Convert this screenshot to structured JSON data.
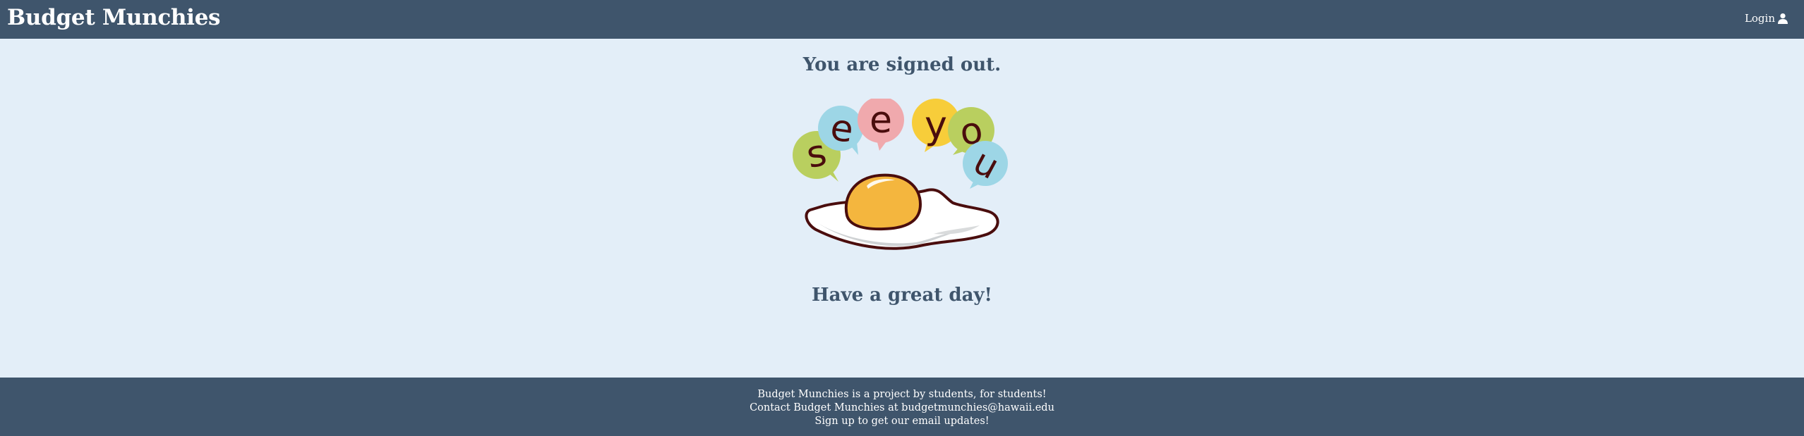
{
  "navbar": {
    "brand": "Budget Munchies",
    "login_label": "Login",
    "login_icon": "user-icon"
  },
  "main": {
    "heading": "You are signed out.",
    "image_text": "see you",
    "subheading": "Have a great day!"
  },
  "footer": {
    "line1": "Budget Munchies is a project by students, for students!",
    "line2": "Contact Budget Munchies at budgetmunchies@hawaii.edu",
    "line3": "Sign up to get our email updates!"
  },
  "colors": {
    "navbar_bg": "#3f556c",
    "page_bg": "#e3eef8",
    "heading": "#3f556c",
    "yolk": "#f4b63e",
    "outline": "#4a0d0d"
  }
}
